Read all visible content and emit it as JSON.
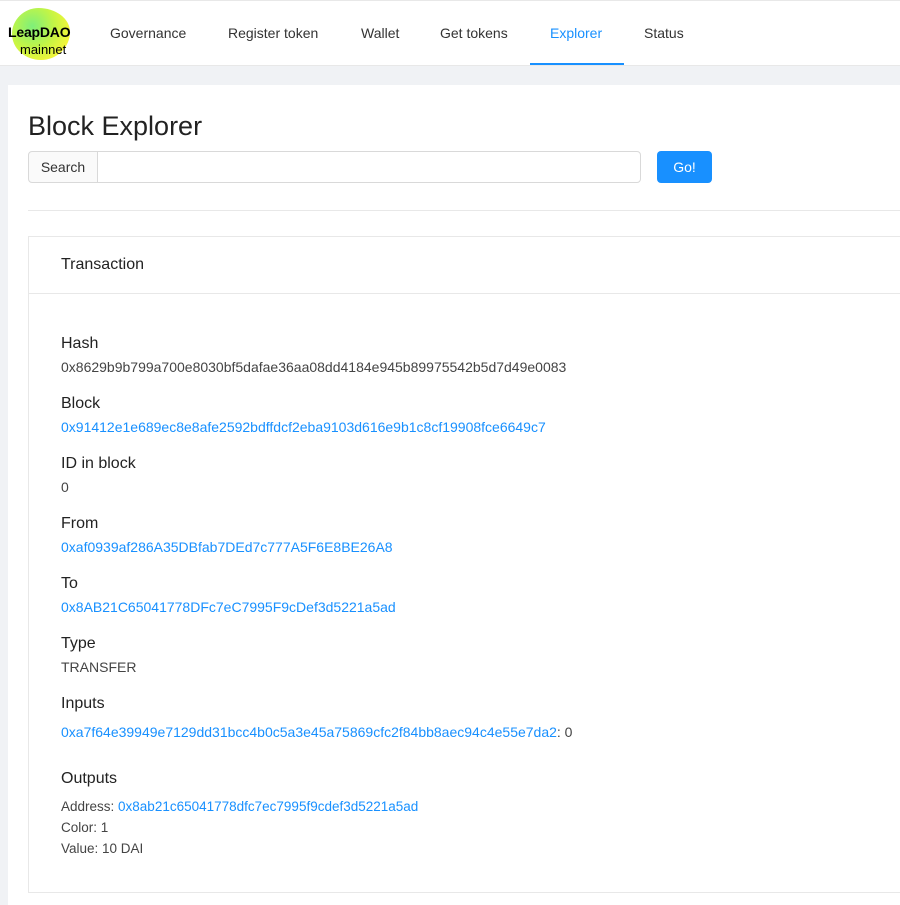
{
  "brand": {
    "name": "LeapDAO",
    "network": "mainnet"
  },
  "nav": {
    "items": [
      {
        "label": "Governance"
      },
      {
        "label": "Register token"
      },
      {
        "label": "Wallet"
      },
      {
        "label": "Get tokens"
      },
      {
        "label": "Explorer",
        "active": true
      },
      {
        "label": "Status"
      }
    ]
  },
  "page": {
    "title": "Block Explorer"
  },
  "search": {
    "addon_label": "Search",
    "value": "",
    "placeholder": "",
    "button_label": "Go!"
  },
  "transaction": {
    "card_title": "Transaction",
    "hash": {
      "label": "Hash",
      "value": "0x8629b9b799a700e8030bf5dafae36aa08dd4184e945b89975542b5d7d49e0083"
    },
    "block": {
      "label": "Block",
      "value": "0x91412e1e689ec8e8afe2592bdffdcf2eba9103d616e9b1c8cf19908fce6649c7"
    },
    "id_in_block": {
      "label": "ID in block",
      "value": "0"
    },
    "from": {
      "label": "From",
      "value": "0xaf0939af286A35DBfab7DEd7c777A5F6E8BE26A8"
    },
    "to": {
      "label": "To",
      "value": "0x8AB21C65041778DFc7eC7995F9cDef3d5221a5ad"
    },
    "type": {
      "label": "Type",
      "value": "TRANSFER"
    },
    "inputs": {
      "label": "Inputs",
      "hash": "0xa7f64e39949e7129dd31bcc4b0c5a3e45a75869cfc2f84bb8aec94c4e55e7da2",
      "index_text": ": 0"
    },
    "outputs": {
      "label": "Outputs",
      "address_label": "Address: ",
      "address": "0x8ab21c65041778dfc7ec7995f9cdef3d5221a5ad",
      "color_text": "Color: 1",
      "value_text": "Value: 10 DAI"
    }
  },
  "colors": {
    "accent": "#1890ff",
    "background": "#f0f2f5"
  }
}
